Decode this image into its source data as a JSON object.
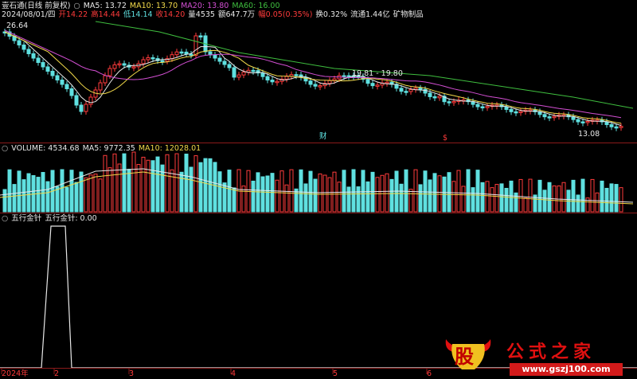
{
  "header": {
    "line1": [
      {
        "text": "壹石通(日线 前复权)",
        "color": "#e8e8e8"
      },
      {
        "text": "○",
        "color": "#bbbbbb"
      },
      {
        "text": "MA5: 13.72",
        "color": "#e8e8e8"
      },
      {
        "text": "MA10: 13.70",
        "color": "#f2d94a"
      },
      {
        "text": "MA20: 13.80",
        "color": "#d34fd3"
      },
      {
        "text": "MA60: 16.00",
        "color": "#3fbf3f"
      }
    ],
    "line2": [
      {
        "text": "2024/08/01/四",
        "color": "#e8e8e8"
      },
      {
        "text": "开14.22",
        "color": "#ff3b3b"
      },
      {
        "text": "高14.44",
        "color": "#ff3b3b"
      },
      {
        "text": "低14.14",
        "color": "#5fe0e0"
      },
      {
        "text": "收14.20",
        "color": "#ff3b3b"
      },
      {
        "text": "量4535",
        "color": "#e8e8e8"
      },
      {
        "text": "额647.7万",
        "color": "#e8e8e8"
      },
      {
        "text": "幅0.05(0.35%)",
        "color": "#ff3b3b"
      },
      {
        "text": "换0.32%",
        "color": "#e8e8e8"
      },
      {
        "text": "流通1.44亿",
        "color": "#e8e8e8"
      },
      {
        "text": "矿物制品",
        "color": "#e8e8e8"
      }
    ]
  },
  "price_chart": {
    "high_label": "26.64",
    "mid_label": "19.81 - 19.80",
    "low_label": "13.08",
    "marker_cai": "财",
    "marker_s": "$"
  },
  "volume_header": [
    {
      "text": "○",
      "color": "#bbbbbb"
    },
    {
      "text": "VOLUME: 4534.68",
      "color": "#e8e8e8"
    },
    {
      "text": "MA5: 9772.35",
      "color": "#e8e8e8"
    },
    {
      "text": "MA10: 12028.01",
      "color": "#f2d94a"
    }
  ],
  "indicator_header": [
    {
      "text": "○",
      "color": "#bbbbbb"
    },
    {
      "text": "五行金针",
      "color": "#e8e8e8"
    },
    {
      "text": "五行金针: 0.00",
      "color": "#e8e8e8"
    }
  ],
  "x_axis": {
    "labels": [
      "2024年",
      "2",
      "3",
      "4",
      "5",
      "6"
    ]
  },
  "watermark": {
    "badge_char": "股",
    "brand": "公式之家",
    "url": "www.gszj100.com"
  },
  "colors": {
    "up": "#ff3b3b",
    "down": "#5fe0e0",
    "ma5": "#e8e8e8",
    "ma10": "#f2d94a",
    "ma20": "#d34fd3",
    "ma60": "#3fbf3f",
    "grid": "#8b1a1a"
  }
}
